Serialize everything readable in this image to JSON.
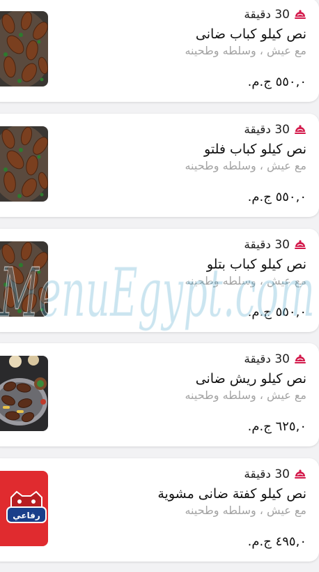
{
  "items": [
    {
      "time": "30 دقيقة",
      "title": "نص كيلو كباب ضانى",
      "description": "مع عيش ، وسلطه وطحينه",
      "price": "٥٥٠,٠ ج.م."
    },
    {
      "time": "30 دقيقة",
      "title": "نص كيلو كباب فلتو",
      "description": "مع عيش ، وسلطه وطحينه",
      "price": "٥٥٠,٠ ج.م."
    },
    {
      "time": "30 دقيقة",
      "title": "نص كيلو كباب بتلو",
      "description": "مع عيش ، وسلطه وطحينه",
      "price": "٥٥٠,٠ ج.م."
    },
    {
      "time": "30 دقيقة",
      "title": "نص كيلو ريش ضانى",
      "description": "مع عيش ، وسلطه وطحينه",
      "price": "٦٢٥,٠ ج.م."
    },
    {
      "time": "30 دقيقة",
      "title": "نص كيلو كفتة ضانى مشوية",
      "description": "مع عيش ، وسلطه وطحينه",
      "price": "٤٩٥,٠ ج.م."
    }
  ],
  "logo_text": "رفاعي",
  "watermark_text": "MenuEgypt.com",
  "icons": {
    "time_icon": "dish-cloche-icon"
  },
  "colors": {
    "accent": "#d3184a",
    "logo_bg": "#e02b2f"
  }
}
